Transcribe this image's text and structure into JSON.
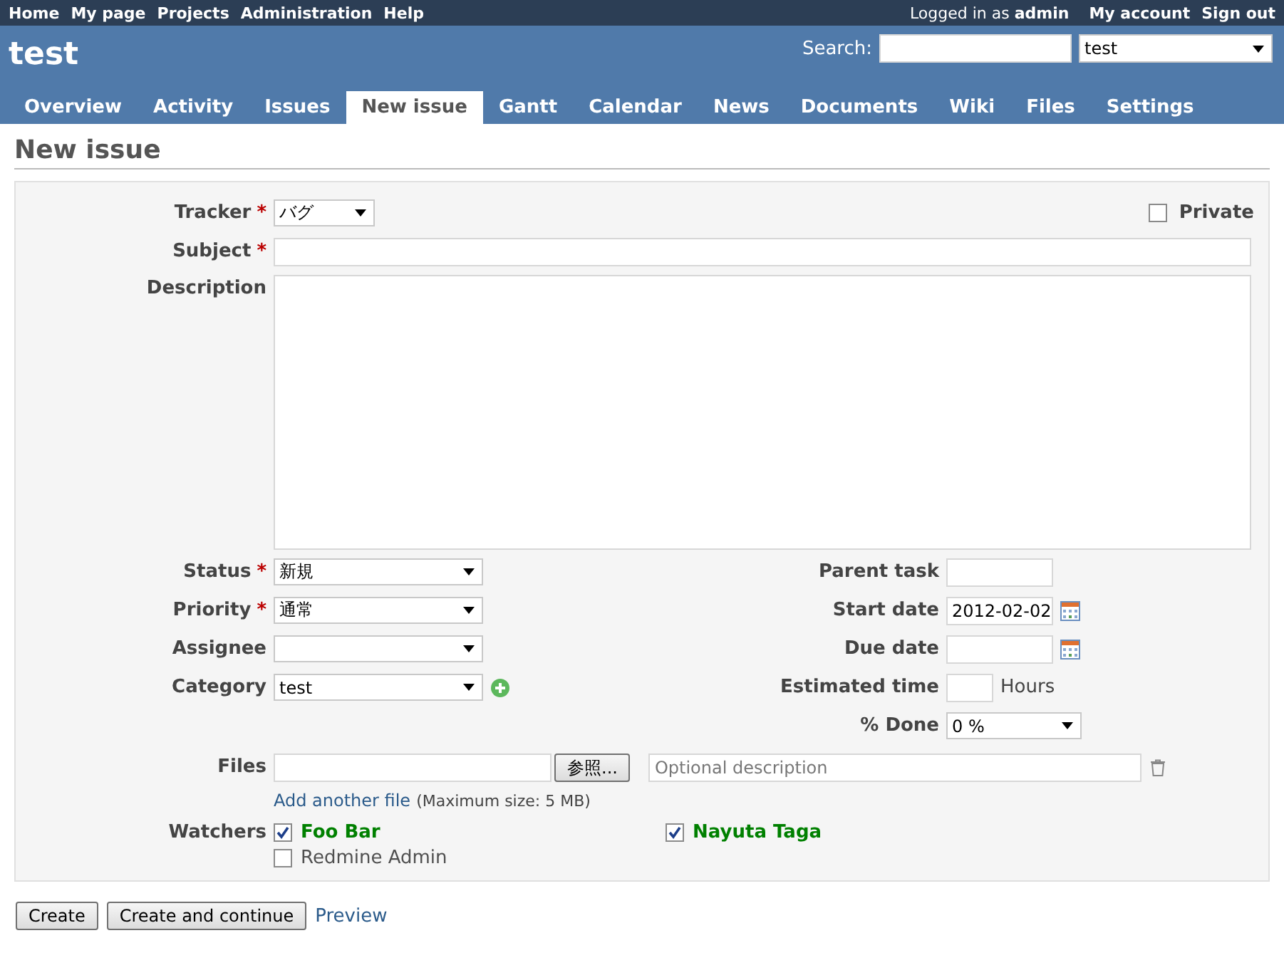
{
  "top_menu": {
    "left": [
      "Home",
      "My page",
      "Projects",
      "Administration",
      "Help"
    ],
    "logged_in": {
      "prefix": "Logged in as",
      "user": "admin"
    },
    "right": [
      "My account",
      "Sign out"
    ]
  },
  "header": {
    "project_title": "test",
    "search_label": "Search:",
    "project_jump": "test"
  },
  "tabs": [
    {
      "label": "Overview",
      "selected": false
    },
    {
      "label": "Activity",
      "selected": false
    },
    {
      "label": "Issues",
      "selected": false
    },
    {
      "label": "New issue",
      "selected": true
    },
    {
      "label": "Gantt",
      "selected": false
    },
    {
      "label": "Calendar",
      "selected": false
    },
    {
      "label": "News",
      "selected": false
    },
    {
      "label": "Documents",
      "selected": false
    },
    {
      "label": "Wiki",
      "selected": false
    },
    {
      "label": "Files",
      "selected": false
    },
    {
      "label": "Settings",
      "selected": false
    }
  ],
  "page_title": "New issue",
  "form": {
    "tracker": {
      "label": "Tracker",
      "required_mark": "*",
      "value": "バグ"
    },
    "private": {
      "label": "Private",
      "checked": false
    },
    "subject": {
      "label": "Subject",
      "required_mark": "*"
    },
    "description": {
      "label": "Description"
    },
    "left_fields": [
      {
        "label": "Status",
        "required_mark": "*",
        "kind": "select",
        "value": "新規"
      },
      {
        "label": "Priority",
        "required_mark": "*",
        "kind": "select",
        "value": "通常"
      },
      {
        "label": "Assignee",
        "kind": "select"
      },
      {
        "label": "Category",
        "kind": "select",
        "value": "test",
        "add_icon": true
      }
    ],
    "right_fields": [
      {
        "label": "Parent task",
        "kind": "text"
      },
      {
        "label": "Start date",
        "kind": "date",
        "value": "2012-02-02"
      },
      {
        "label": "Due date",
        "kind": "date"
      },
      {
        "label": "Estimated time",
        "kind": "hours",
        "unit": "Hours"
      },
      {
        "label": "% Done",
        "kind": "select",
        "value": "0 %"
      }
    ],
    "files": {
      "label": "Files",
      "browse_button": "参照...",
      "description_placeholder": "Optional description",
      "add_link": "Add another file",
      "max_size": "(Maximum size: 5 MB)"
    },
    "watchers": {
      "label": "Watchers",
      "users": [
        {
          "name": "Foo Bar",
          "checked": true
        },
        {
          "name": "Nayuta Taga",
          "checked": true
        },
        {
          "name": "Redmine Admin",
          "checked": false
        }
      ]
    }
  },
  "actions": [
    {
      "label": "Create",
      "kind": "button"
    },
    {
      "label": "Create and continue",
      "kind": "button"
    },
    {
      "label": "Preview",
      "kind": "link"
    }
  ]
}
